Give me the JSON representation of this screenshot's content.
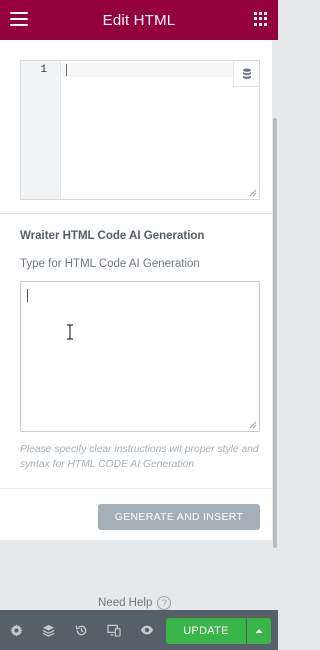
{
  "header": {
    "title": "Edit HTML"
  },
  "code_editor": {
    "line_number": "1",
    "value": ""
  },
  "ai_section": {
    "title": "Wraiter HTML Code AI Generation",
    "field_label": "Type for HTML Code AI Generation",
    "prompt_value": "",
    "hint": "Please specify clear instructions wit proper style and syntax for HTML CODE AI Generation",
    "generate_label": "GENERATE AND INSERT"
  },
  "help": {
    "label": "Need Help",
    "icon": "?"
  },
  "footer": {
    "icons": [
      "settings-icon",
      "navigator-icon",
      "history-icon",
      "responsive-icon",
      "preview-icon"
    ],
    "update_label": "UPDATE"
  },
  "colors": {
    "brand": "#93003c",
    "update": "#39b54a",
    "footer": "#556068",
    "disabled_button": "#a4afb7"
  }
}
